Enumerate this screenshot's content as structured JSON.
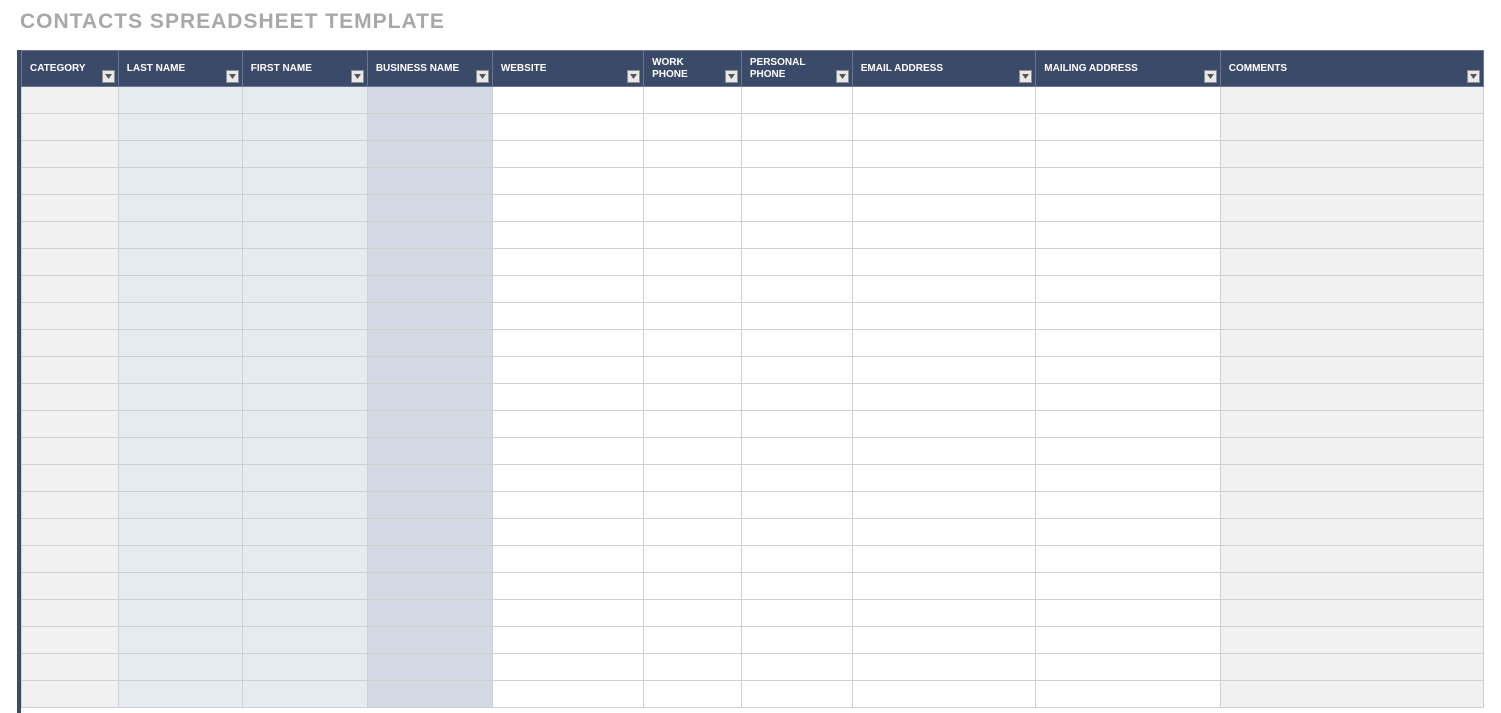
{
  "title": "CONTACTS SPREADSHEET TEMPLATE",
  "columns": [
    {
      "key": "category",
      "label": "CATEGORY"
    },
    {
      "key": "last_name",
      "label": "LAST NAME"
    },
    {
      "key": "first_name",
      "label": "FIRST NAME"
    },
    {
      "key": "business_name",
      "label": "BUSINESS NAME"
    },
    {
      "key": "website",
      "label": "WEBSITE"
    },
    {
      "key": "work_phone",
      "label": "WORK PHONE"
    },
    {
      "key": "personal_phone",
      "label": "PERSONAL PHONE"
    },
    {
      "key": "email_address",
      "label": "EMAIL ADDRESS"
    },
    {
      "key": "mailing_address",
      "label": "MAILING ADDRESS"
    },
    {
      "key": "comments",
      "label": "COMMENTS"
    }
  ],
  "rows": [
    {
      "category": "",
      "last_name": "",
      "first_name": "",
      "business_name": "",
      "website": "",
      "work_phone": "",
      "personal_phone": "",
      "email_address": "",
      "mailing_address": "",
      "comments": ""
    },
    {
      "category": "",
      "last_name": "",
      "first_name": "",
      "business_name": "",
      "website": "",
      "work_phone": "",
      "personal_phone": "",
      "email_address": "",
      "mailing_address": "",
      "comments": ""
    },
    {
      "category": "",
      "last_name": "",
      "first_name": "",
      "business_name": "",
      "website": "",
      "work_phone": "",
      "personal_phone": "",
      "email_address": "",
      "mailing_address": "",
      "comments": ""
    },
    {
      "category": "",
      "last_name": "",
      "first_name": "",
      "business_name": "",
      "website": "",
      "work_phone": "",
      "personal_phone": "",
      "email_address": "",
      "mailing_address": "",
      "comments": ""
    },
    {
      "category": "",
      "last_name": "",
      "first_name": "",
      "business_name": "",
      "website": "",
      "work_phone": "",
      "personal_phone": "",
      "email_address": "",
      "mailing_address": "",
      "comments": ""
    },
    {
      "category": "",
      "last_name": "",
      "first_name": "",
      "business_name": "",
      "website": "",
      "work_phone": "",
      "personal_phone": "",
      "email_address": "",
      "mailing_address": "",
      "comments": ""
    },
    {
      "category": "",
      "last_name": "",
      "first_name": "",
      "business_name": "",
      "website": "",
      "work_phone": "",
      "personal_phone": "",
      "email_address": "",
      "mailing_address": "",
      "comments": ""
    },
    {
      "category": "",
      "last_name": "",
      "first_name": "",
      "business_name": "",
      "website": "",
      "work_phone": "",
      "personal_phone": "",
      "email_address": "",
      "mailing_address": "",
      "comments": ""
    },
    {
      "category": "",
      "last_name": "",
      "first_name": "",
      "business_name": "",
      "website": "",
      "work_phone": "",
      "personal_phone": "",
      "email_address": "",
      "mailing_address": "",
      "comments": ""
    },
    {
      "category": "",
      "last_name": "",
      "first_name": "",
      "business_name": "",
      "website": "",
      "work_phone": "",
      "personal_phone": "",
      "email_address": "",
      "mailing_address": "",
      "comments": ""
    },
    {
      "category": "",
      "last_name": "",
      "first_name": "",
      "business_name": "",
      "website": "",
      "work_phone": "",
      "personal_phone": "",
      "email_address": "",
      "mailing_address": "",
      "comments": ""
    },
    {
      "category": "",
      "last_name": "",
      "first_name": "",
      "business_name": "",
      "website": "",
      "work_phone": "",
      "personal_phone": "",
      "email_address": "",
      "mailing_address": "",
      "comments": ""
    },
    {
      "category": "",
      "last_name": "",
      "first_name": "",
      "business_name": "",
      "website": "",
      "work_phone": "",
      "personal_phone": "",
      "email_address": "",
      "mailing_address": "",
      "comments": ""
    },
    {
      "category": "",
      "last_name": "",
      "first_name": "",
      "business_name": "",
      "website": "",
      "work_phone": "",
      "personal_phone": "",
      "email_address": "",
      "mailing_address": "",
      "comments": ""
    },
    {
      "category": "",
      "last_name": "",
      "first_name": "",
      "business_name": "",
      "website": "",
      "work_phone": "",
      "personal_phone": "",
      "email_address": "",
      "mailing_address": "",
      "comments": ""
    },
    {
      "category": "",
      "last_name": "",
      "first_name": "",
      "business_name": "",
      "website": "",
      "work_phone": "",
      "personal_phone": "",
      "email_address": "",
      "mailing_address": "",
      "comments": ""
    },
    {
      "category": "",
      "last_name": "",
      "first_name": "",
      "business_name": "",
      "website": "",
      "work_phone": "",
      "personal_phone": "",
      "email_address": "",
      "mailing_address": "",
      "comments": ""
    },
    {
      "category": "",
      "last_name": "",
      "first_name": "",
      "business_name": "",
      "website": "",
      "work_phone": "",
      "personal_phone": "",
      "email_address": "",
      "mailing_address": "",
      "comments": ""
    },
    {
      "category": "",
      "last_name": "",
      "first_name": "",
      "business_name": "",
      "website": "",
      "work_phone": "",
      "personal_phone": "",
      "email_address": "",
      "mailing_address": "",
      "comments": ""
    },
    {
      "category": "",
      "last_name": "",
      "first_name": "",
      "business_name": "",
      "website": "",
      "work_phone": "",
      "personal_phone": "",
      "email_address": "",
      "mailing_address": "",
      "comments": ""
    },
    {
      "category": "",
      "last_name": "",
      "first_name": "",
      "business_name": "",
      "website": "",
      "work_phone": "",
      "personal_phone": "",
      "email_address": "",
      "mailing_address": "",
      "comments": ""
    },
    {
      "category": "",
      "last_name": "",
      "first_name": "",
      "business_name": "",
      "website": "",
      "work_phone": "",
      "personal_phone": "",
      "email_address": "",
      "mailing_address": "",
      "comments": ""
    },
    {
      "category": "",
      "last_name": "",
      "first_name": "",
      "business_name": "",
      "website": "",
      "work_phone": "",
      "personal_phone": "",
      "email_address": "",
      "mailing_address": "",
      "comments": ""
    }
  ]
}
